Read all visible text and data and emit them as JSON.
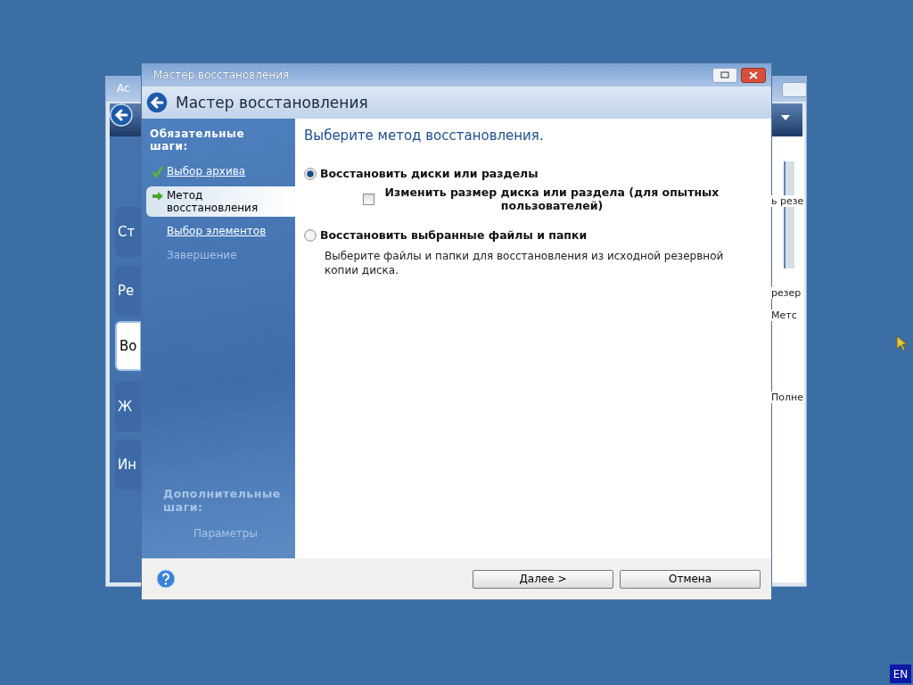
{
  "background_window": {
    "title": "Ac",
    "sidebar_items": [
      {
        "label": "Ст",
        "selected": false
      },
      {
        "label": "Ре",
        "selected": false
      },
      {
        "label": "Во",
        "selected": true
      },
      {
        "label": "Ж",
        "selected": false
      },
      {
        "label": "Ин",
        "selected": false
      }
    ],
    "column_texts": [
      "ь резе",
      "резер",
      "Метс",
      "Полне"
    ]
  },
  "wizard": {
    "title": "Мастер восстановления",
    "header": "Мастер восстановления",
    "required_heading": "Обязательные шаги:",
    "steps": [
      {
        "label": "Выбор архива",
        "done": true,
        "current": false,
        "enabled": true
      },
      {
        "label": "Метод восстановления",
        "done": false,
        "current": true,
        "enabled": true
      },
      {
        "label": "Выбор элементов",
        "done": false,
        "current": false,
        "enabled": true
      },
      {
        "label": "Завершение",
        "done": false,
        "current": false,
        "enabled": false
      }
    ],
    "optional_heading": "Дополнительные шаги:",
    "optional_steps": [
      {
        "label": "Параметры",
        "done": false,
        "current": false,
        "enabled": false
      }
    ],
    "prompt": "Выберите метод восстановления.",
    "options": [
      {
        "kind": "radio",
        "label": "Восстановить диски или разделы",
        "selected": true
      },
      {
        "kind": "checkbox",
        "label": "Изменить размер диска или раздела (для опытных пользователей)",
        "checked": false
      },
      {
        "kind": "radio",
        "label": "Восстановить выбранные файлы и папки",
        "selected": false,
        "description": "Выберите файлы и папки для восстановления из исходной резервной копии диска."
      }
    ],
    "buttons": [
      "Далее >",
      "Отмена"
    ]
  },
  "language": "EN"
}
